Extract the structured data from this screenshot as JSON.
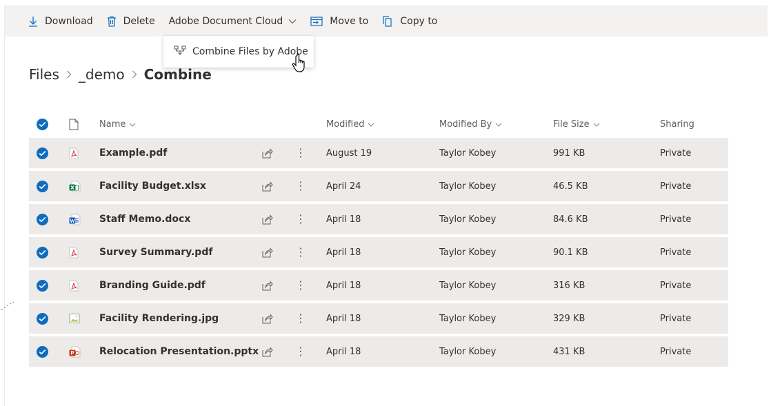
{
  "command_bar": {
    "download": "Download",
    "delete": "Delete",
    "adobe_cloud": "Adobe Document Cloud",
    "move_to": "Move to",
    "copy_to": "Copy to"
  },
  "dropdown": {
    "combine": "Combine Files by Adobe"
  },
  "breadcrumb": {
    "items": [
      "Files",
      "_demo",
      "Combine"
    ]
  },
  "columns": {
    "name": "Name",
    "modified": "Modified",
    "modified_by": "Modified By",
    "file_size": "File Size",
    "sharing": "Sharing"
  },
  "rows": [
    {
      "icon": "pdf-file-icon",
      "name": "Example.pdf",
      "modified": "August 19",
      "modified_by": "Taylor Kobey",
      "size": "991 KB",
      "sharing": "Private"
    },
    {
      "icon": "excel-file-icon",
      "name": "Facility Budget.xlsx",
      "modified": "April 24",
      "modified_by": "Taylor Kobey",
      "size": "46.5 KB",
      "sharing": "Private"
    },
    {
      "icon": "word-file-icon",
      "name": "Staff Memo.docx",
      "modified": "April 18",
      "modified_by": "Taylor Kobey",
      "size": "84.6 KB",
      "sharing": "Private"
    },
    {
      "icon": "pdf-file-icon",
      "name": "Survey Summary.pdf",
      "modified": "April 18",
      "modified_by": "Taylor Kobey",
      "size": "90.1 KB",
      "sharing": "Private"
    },
    {
      "icon": "pdf-file-icon",
      "name": "Branding Guide.pdf",
      "modified": "April 18",
      "modified_by": "Taylor Kobey",
      "size": "316 KB",
      "sharing": "Private"
    },
    {
      "icon": "image-file-icon",
      "name": "Facility Rendering.jpg",
      "modified": "April 18",
      "modified_by": "Taylor Kobey",
      "size": "329 KB",
      "sharing": "Private"
    },
    {
      "icon": "powerpoint-file-icon",
      "name": "Relocation Presentation.pptx",
      "modified": "April 18",
      "modified_by": "Taylor Kobey",
      "size": "431 KB",
      "sharing": "Private"
    }
  ],
  "colors": {
    "accent": "#0f6cbd",
    "selected_row": "#edebe9",
    "command_bar": "#f3f2f1",
    "pdf": "#d13438",
    "excel": "#107c41",
    "word": "#185abd",
    "powerpoint": "#c43e1c"
  }
}
